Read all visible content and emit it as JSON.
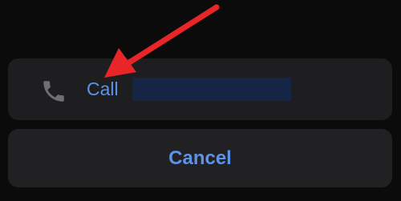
{
  "sheet": {
    "call_option": {
      "label": "Call",
      "icon": "phone-icon",
      "number_redacted": true
    },
    "cancel_label": "Cancel"
  },
  "colors": {
    "background": "#0b0b0c",
    "option_bg": "#1e1e20",
    "action_text": "#5b93e6",
    "redaction": "#152545",
    "arrow": "#e8262a"
  }
}
